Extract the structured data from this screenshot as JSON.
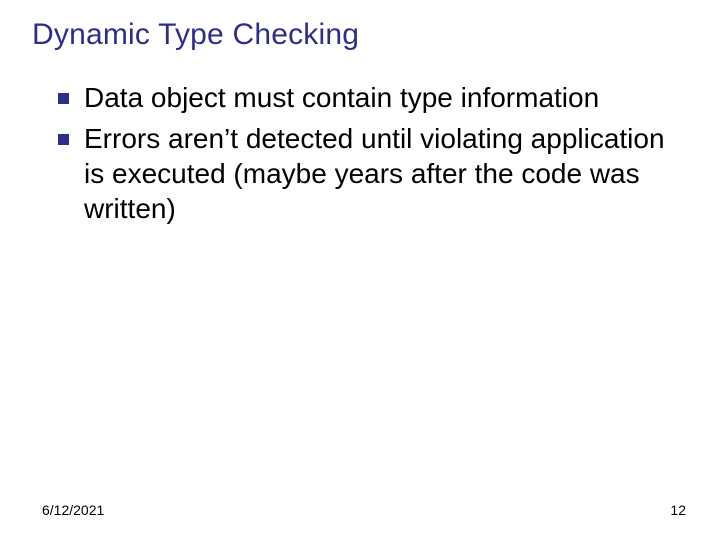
{
  "title": "Dynamic Type Checking",
  "bullets": [
    "Data object must contain type information",
    "Errors aren’t detected until violating application is executed (maybe years after the code was written)"
  ],
  "footer": {
    "date": "6/12/2021",
    "page": "12"
  }
}
